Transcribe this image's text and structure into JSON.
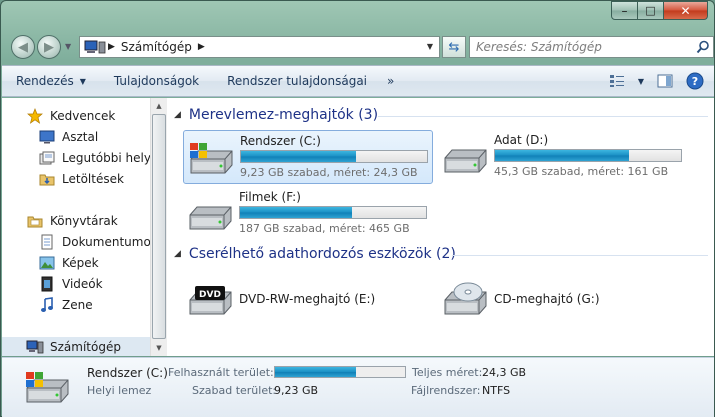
{
  "window": {
    "caption_buttons": {
      "minimize": "–",
      "maximize": "□",
      "close": "✕"
    }
  },
  "address": {
    "location": "Számítógép",
    "search_placeholder": "Keresés: Számítógép"
  },
  "toolbar": {
    "organize": "Rendezés",
    "properties": "Tulajdonságok",
    "system_properties": "Rendszer tulajdonságai",
    "more": "»"
  },
  "nav": {
    "favorites": "Kedvencek",
    "desktop": "Asztal",
    "recent": "Legutóbbi helyek",
    "downloads": "Letöltések",
    "libraries": "Könyvtárak",
    "documents": "Dokumentumok",
    "pictures": "Képek",
    "videos": "Videók",
    "music": "Zene",
    "computer": "Számítógép"
  },
  "groups": {
    "hard_drives": "Merevlemez-meghajtók (3)",
    "removable": "Cserélhető adathordozós eszközök (2)"
  },
  "drives": [
    {
      "name": "Rendszer (C:)",
      "free_text": "9,23 GB szabad, méret: 24,3 GB",
      "used_fraction": 0.62
    },
    {
      "name": "Adat (D:)",
      "free_text": "45,3 GB szabad, méret: 161 GB",
      "used_fraction": 0.72
    },
    {
      "name": "Filmek (F:)",
      "free_text": "187 GB szabad, méret: 465 GB",
      "used_fraction": 0.6
    }
  ],
  "removable": [
    {
      "name": "DVD-RW-meghajtó (E:)",
      "badge": "DVD"
    },
    {
      "name": "CD-meghajtó (G:)"
    }
  ],
  "details": {
    "title": "Rendszer (C:)",
    "subtitle": "Helyi lemez",
    "used_label": "Felhasznált terület:",
    "used_fraction": 0.62,
    "free_label": "Szabad terület:",
    "free_value": "9,23 GB",
    "total_label": "Teljes méret:",
    "total_value": "24,3 GB",
    "fs_label": "Fájlrendszer:",
    "fs_value": "NTFS"
  },
  "colors": {
    "accent": "#1e3287",
    "bar_fill": "#1a8fc4",
    "selection": "#d4e8fb"
  }
}
